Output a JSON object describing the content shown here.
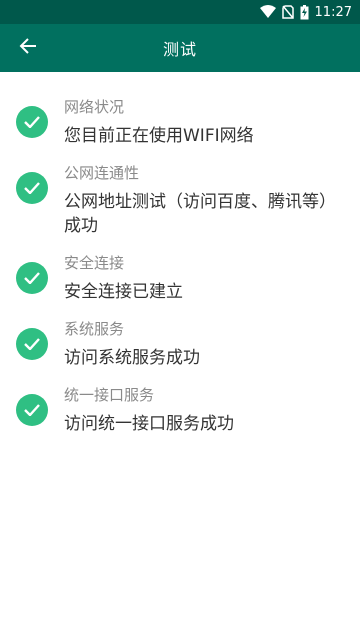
{
  "status_bar": {
    "time": "11:27"
  },
  "app_bar": {
    "title": "测试"
  },
  "items": [
    {
      "title": "网络状况",
      "description": "您目前正在使用WIFI网络"
    },
    {
      "title": "公网连通性",
      "description": "公网地址测试（访问百度、腾讯等）成功"
    },
    {
      "title": "安全连接",
      "description": "安全连接已建立"
    },
    {
      "title": "系统服务",
      "description": "访问系统服务成功"
    },
    {
      "title": "统一接口服务",
      "description": "访问统一接口服务成功"
    }
  ],
  "colors": {
    "status_bar": "#00584b",
    "app_bar": "#01705f",
    "check": "#2fbf83"
  }
}
